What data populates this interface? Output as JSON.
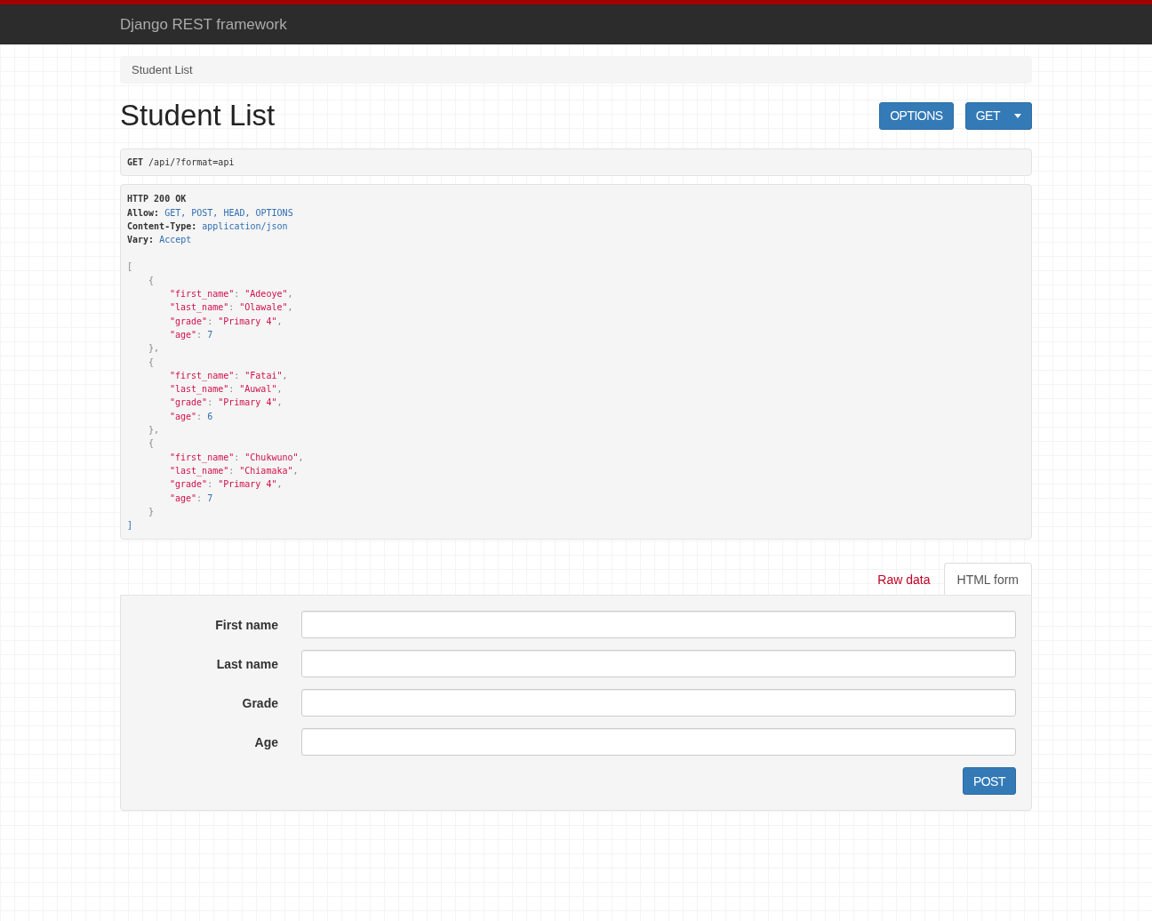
{
  "navbar": {
    "brand": "Django REST framework"
  },
  "breadcrumb": [
    {
      "label": "Student List",
      "selected": true
    }
  ],
  "page": {
    "title": "Student List",
    "buttons": [
      {
        "label": "OPTIONS",
        "kind": "plain"
      },
      {
        "label": "GET",
        "kind": "dropdown"
      }
    ]
  },
  "request": {
    "method": "GET",
    "path": "/api/?format=api"
  },
  "response": {
    "status": "HTTP 200 OK",
    "headers": [
      {
        "name": "Allow:",
        "value": "GET, POST, HEAD, OPTIONS"
      },
      {
        "name": "Content-Type:",
        "value": "application/json"
      },
      {
        "name": "Vary:",
        "value": "Accept"
      }
    ],
    "body": {
      "open": "[",
      "close": "]",
      "children": [
        {
          "open": "{",
          "close": "},",
          "fields": [
            {
              "key": "\"first_name\"",
              "sep": ": ",
              "value": "\"Adeoye\"",
              "kind": "string",
              "end": ","
            },
            {
              "key": "\"last_name\"",
              "sep": ": ",
              "value": "\"Olawale\"",
              "kind": "string",
              "end": ","
            },
            {
              "key": "\"grade\"",
              "sep": ": ",
              "value": "\"Primary 4\"",
              "kind": "string",
              "end": ","
            },
            {
              "key": "\"age\"",
              "sep": ": ",
              "value": "7",
              "kind": "number"
            }
          ]
        },
        {
          "open": "{",
          "close": "},",
          "fields": [
            {
              "key": "\"first_name\"",
              "sep": ": ",
              "value": "\"Fatai\"",
              "kind": "string",
              "end": ","
            },
            {
              "key": "\"last_name\"",
              "sep": ": ",
              "value": "\"Auwal\"",
              "kind": "string",
              "end": ","
            },
            {
              "key": "\"grade\"",
              "sep": ": ",
              "value": "\"Primary 4\"",
              "kind": "string",
              "end": ","
            },
            {
              "key": "\"age\"",
              "sep": ": ",
              "value": "6",
              "kind": "number"
            }
          ]
        },
        {
          "open": "{",
          "close": "}",
          "fields": [
            {
              "key": "\"first_name\"",
              "sep": ": ",
              "value": "\"Chukwuno\"",
              "kind": "string",
              "end": ","
            },
            {
              "key": "\"last_name\"",
              "sep": ": ",
              "value": "\"Chiamaka\"",
              "kind": "string",
              "end": ","
            },
            {
              "key": "\"grade\"",
              "sep": ": ",
              "value": "\"Primary 4\"",
              "kind": "string",
              "end": ","
            },
            {
              "key": "\"age\"",
              "sep": ": ",
              "value": "7",
              "kind": "number"
            }
          ]
        }
      ]
    }
  },
  "form_tabs": [
    {
      "label": "Raw data",
      "selected": false
    },
    {
      "label": "HTML form",
      "selected": true
    }
  ],
  "form": {
    "fields": [
      {
        "label": "First name"
      },
      {
        "label": "Last name"
      },
      {
        "label": "Grade"
      },
      {
        "label": "Age"
      }
    ],
    "submit": "POST"
  }
}
